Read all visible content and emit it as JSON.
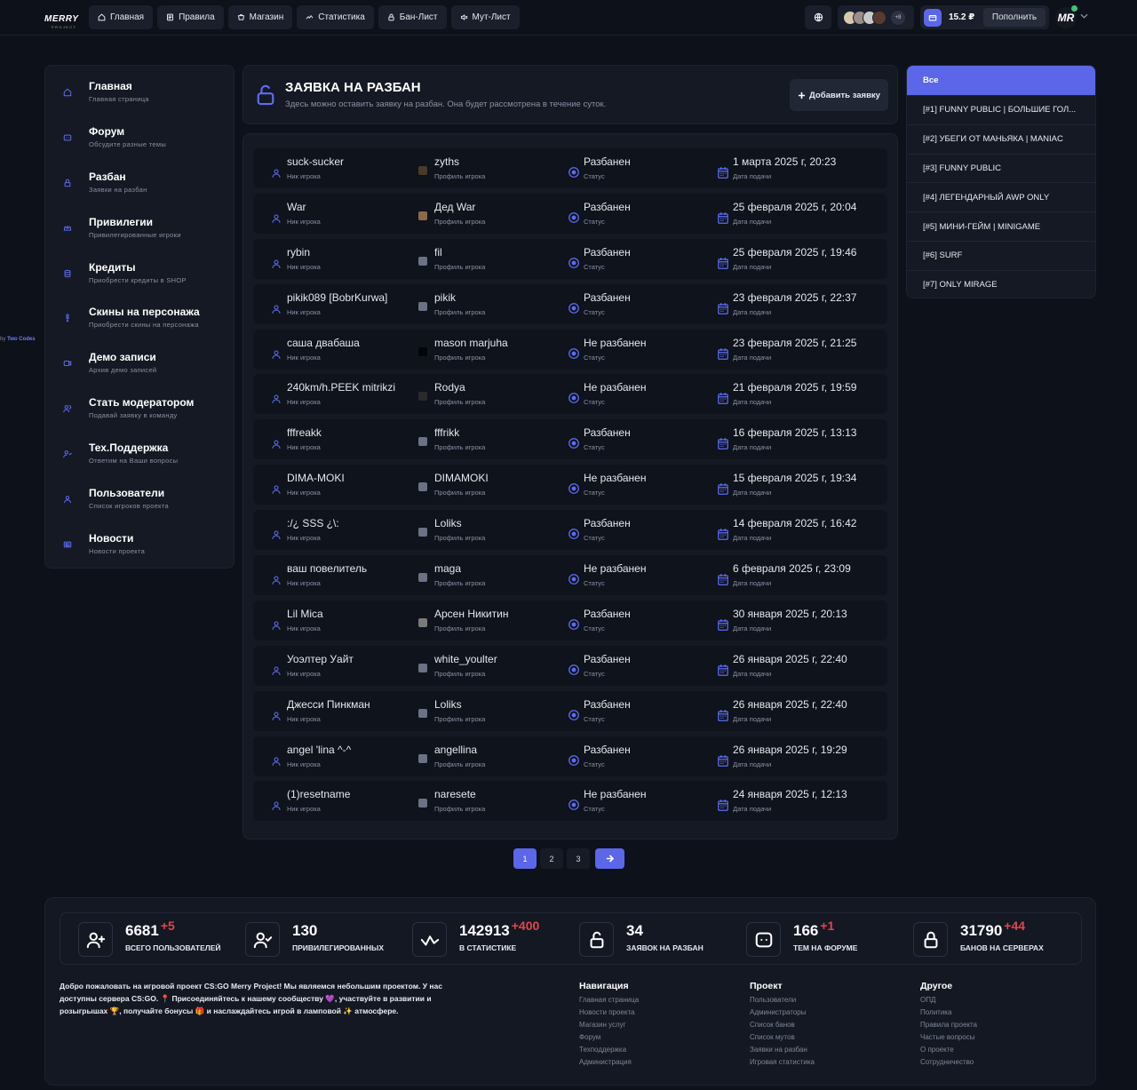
{
  "logo": {
    "line1": "MERRY",
    "line2": "PROJECT"
  },
  "nav": [
    {
      "label": "Главная",
      "icon": "home-icon"
    },
    {
      "label": "Правила",
      "icon": "rules-icon"
    },
    {
      "label": "Магазин",
      "icon": "shop-icon"
    },
    {
      "label": "Статистика",
      "icon": "stats-icon"
    },
    {
      "label": "Бан-Лист",
      "icon": "lock-icon"
    },
    {
      "label": "Мут-Лист",
      "icon": "mute-icon"
    }
  ],
  "online_more": "+8",
  "wallet": {
    "balance": "15.2 ₽",
    "topup": "Пополнить"
  },
  "user_initials": "MR",
  "sidebar": [
    {
      "title": "Главная",
      "sub": "Главная страница"
    },
    {
      "title": "Форум",
      "sub": "Обсудите разные темы"
    },
    {
      "title": "Разбан",
      "sub": "Заявки на разбан"
    },
    {
      "title": "Привилегии",
      "sub": "Привилегированные игроки"
    },
    {
      "title": "Кредиты",
      "sub": "Приобрести кредиты в SHOP"
    },
    {
      "title": "Скины на персонажа",
      "sub": "Приобрести скины на персонажа"
    },
    {
      "title": "Демо записи",
      "sub": "Архив демо записей"
    },
    {
      "title": "Стать модератором",
      "sub": "Подавай заявку в команду"
    },
    {
      "title": "Тех.Поддержка",
      "sub": "Ответим на Ваши вопросы"
    },
    {
      "title": "Пользователи",
      "sub": "Список игроков проекта"
    },
    {
      "title": "Новости",
      "sub": "Новости проекта"
    }
  ],
  "credit": {
    "prefix": "by",
    "name": "Two Codes"
  },
  "header": {
    "title": "ЗАЯВКА НА РАЗБАН",
    "subtitle": "Здесь можно оставить заявку на разбан. Она будет рассмотрена в течение суток.",
    "add_button": "Добавить заявку"
  },
  "labels": {
    "nick": "Ник игрока",
    "profile": "Профиль игрока",
    "status": "Статус",
    "date": "Дата подачи"
  },
  "rows": [
    {
      "nick": "suck-sucker",
      "profile": "zyths",
      "status": "Разбанен",
      "ok": true,
      "date": "1 марта 2025 г, 20:23",
      "avatar": "#4a3a2a"
    },
    {
      "nick": "War",
      "profile": "Дед War",
      "status": "Разбанен",
      "ok": true,
      "date": "25 февраля 2025 г, 20:04",
      "avatar": "#8a6a4a"
    },
    {
      "nick": "rybin",
      "profile": "fil",
      "status": "Разбанен",
      "ok": true,
      "date": "25 февраля 2025 г, 19:46",
      "avatar": "#6b7284"
    },
    {
      "nick": "pikik089 [BobrKurwa]",
      "profile": "pikik",
      "status": "Разбанен",
      "ok": true,
      "date": "23 февраля 2025 г, 22:37",
      "avatar": "#6b7284"
    },
    {
      "nick": "саша двабаша",
      "profile": "mason marjuha",
      "status": "Не разбанен",
      "ok": false,
      "date": "23 февраля 2025 г, 21:25",
      "avatar": "#050505"
    },
    {
      "nick": "240km/h.PEEK mitrikzi",
      "profile": "Rodya",
      "status": "Не разбанен",
      "ok": false,
      "date": "21 февраля 2025 г, 19:59",
      "avatar": "#2a2a2a"
    },
    {
      "nick": "fffreakk",
      "profile": "fffrikk",
      "status": "Разбанен",
      "ok": true,
      "date": "16 февраля 2025 г, 13:13",
      "avatar": "#6b7284"
    },
    {
      "nick": "DIMA-MOKI",
      "profile": "DIMAMOKI",
      "status": "Не разбанен",
      "ok": false,
      "date": "15 февраля 2025 г, 19:34",
      "avatar": "#6b7284"
    },
    {
      "nick": ":/¿ SSS ¿\\:",
      "profile": "Loliks",
      "status": "Разбанен",
      "ok": true,
      "date": "14 февраля 2025 г, 16:42",
      "avatar": "#6b7284"
    },
    {
      "nick": "ваш повелитель",
      "profile": "maga",
      "status": "Не разбанен",
      "ok": false,
      "date": "6 февраля 2025 г, 23:09",
      "avatar": "#6b7284"
    },
    {
      "nick": "Lil Mica",
      "profile": "Арсен Никитин",
      "status": "Разбанен",
      "ok": true,
      "date": "30 января 2025 г, 20:13",
      "avatar": "#7a7a7a"
    },
    {
      "nick": "Уоэлтер Уайт",
      "profile": "white_youlter",
      "status": "Разбанен",
      "ok": true,
      "date": "26 января 2025 г, 22:40",
      "avatar": "#6b7284"
    },
    {
      "nick": "Джесси Пинкман",
      "profile": "Loliks",
      "status": "Разбанен",
      "ok": true,
      "date": "26 января 2025 г, 22:40",
      "avatar": "#6b7284"
    },
    {
      "nick": "angel 'lina ^-^",
      "profile": "angellina",
      "status": "Разбанен",
      "ok": true,
      "date": "26 января 2025 г, 19:29",
      "avatar": "#6b7284"
    },
    {
      "nick": "(1)resetname",
      "profile": "naresete",
      "status": "Не разбанен",
      "ok": false,
      "date": "24 января 2025 г, 12:13",
      "avatar": "#6b7284"
    }
  ],
  "pagination": [
    "1",
    "2",
    "3"
  ],
  "servers": [
    "Все",
    "[#1] FUNNY PUBLIC | БОЛЬШИЕ ГОЛ...",
    "[#2] УБЕГИ ОТ МАНЬЯКА | MANIAC",
    "[#3] FUNNY PUBLIC",
    "[#4] ЛЕГЕНДАРНЫЙ AWP ONLY",
    "[#5] МИНИ-ГЕЙМ | MINIGAME",
    "[#6] SURF",
    "[#7] ONLY MIRAGE"
  ],
  "stats": [
    {
      "value": "6681",
      "inc": "+5",
      "label": "ВСЕГО ПОЛЬЗОВАТЕЛЕЙ",
      "icon": "user-add-icon"
    },
    {
      "value": "130",
      "inc": "",
      "label": "ПРИВИЛЕГИРОВАННЫХ",
      "icon": "user-check-icon"
    },
    {
      "value": "142913",
      "inc": "+400",
      "label": "В СТАТИСТИКЕ",
      "icon": "activity-icon"
    },
    {
      "value": "34",
      "inc": "",
      "label": "ЗАЯВОК НА РАЗБАН",
      "icon": "unlock-icon"
    },
    {
      "value": "166",
      "inc": "+1",
      "label": "ТЕМ НА ФОРУМЕ",
      "icon": "chat-icon"
    },
    {
      "value": "31790",
      "inc": "+44",
      "label": "БАНОВ НА СЕРВЕРАХ",
      "icon": "lock-icon"
    }
  ],
  "about": "Добро пожаловать на игровой проект CS:GO Merry Project! Мы являемся небольшим проектом. У нас доступны сервера CS:GO. 📍 Присоединяйтесь к нашему сообществу 💜, участвуйте в развитии и розыгрышах 🏆, получайте бонусы 🎁 и наслаждайтесь игрой в ламповой ✨ атмосфере.",
  "footer_cols": [
    {
      "title": "Навигация",
      "links": [
        "Главная страница",
        "Новости проекта",
        "Магазин услуг",
        "Форум",
        "Техподдержка",
        "Администрация"
      ]
    },
    {
      "title": "Проект",
      "links": [
        "Пользователи",
        "Администраторы",
        "Список банов",
        "Список мутов",
        "Заявки на разбан",
        "Игровая статистика"
      ]
    },
    {
      "title": "Другое",
      "links": [
        "ОПД",
        "Политика",
        "Правила проекта",
        "Частые вопросы",
        "О проекте",
        "Сотрудничество"
      ]
    }
  ],
  "colors": {
    "accent": "#5b67e8",
    "danger": "#e0464d",
    "bg": "#0d1119",
    "card": "#141923"
  }
}
